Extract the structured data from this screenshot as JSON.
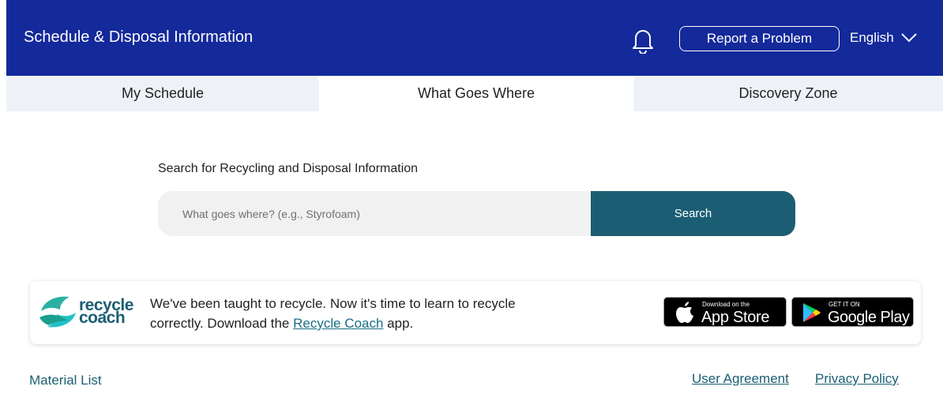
{
  "header": {
    "title": "Schedule & Disposal Information",
    "report_label": "Report a Problem",
    "language": "English",
    "background": "#14299a"
  },
  "tabs": [
    {
      "label": "My Schedule",
      "active": false
    },
    {
      "label": "What Goes Where",
      "active": true
    },
    {
      "label": "Discovery Zone",
      "active": false
    }
  ],
  "search": {
    "heading": "Search for Recycling and Disposal Information",
    "placeholder": "What goes where? (e.g., Styrofoam)",
    "value": "",
    "button_label": "Search",
    "accent": "#1b5e73"
  },
  "banner": {
    "logo_word_1": "recycle",
    "logo_word_2": "coach",
    "text_line_1": "We've been taught to recycle. Now it's time to learn to recycle",
    "text_line_2_prefix": "correctly. Download the ",
    "link_label": "Recycle Coach",
    "text_line_2_suffix": " app."
  },
  "stores": {
    "apple_small": "Download on the",
    "apple_big": "App Store",
    "google_small": "GET IT ON",
    "google_big": "Google Play"
  },
  "footer": {
    "material_list": "Material List",
    "user_agreement": "User Agreement",
    "privacy_policy": "Privacy Policy"
  },
  "icons": [
    "bell-icon",
    "chevron-down-icon",
    "recycle-coach-logo",
    "apple-icon",
    "google-play-icon"
  ]
}
